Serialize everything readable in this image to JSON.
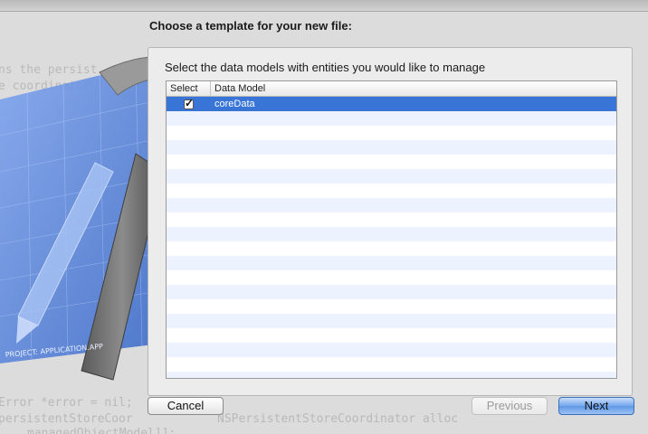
{
  "background_code": {
    "line1": "ns the persist",
    "line2": "e coordinator",
    "line3": "Error *error = nil;",
    "line4": "persistentStoreCoor",
    "line5": "NSPersistentStoreCoordinator alloc",
    "line6": "managedObjectModel]];"
  },
  "dialog": {
    "title": "Choose a template for your new file:",
    "heading": "Select the data models with entities you would like to manage"
  },
  "table": {
    "columns": [
      "Select",
      "Data Model"
    ],
    "rows": [
      {
        "selected_checkbox": true,
        "model": "coreData"
      }
    ]
  },
  "buttons": {
    "cancel": "Cancel",
    "previous": "Previous",
    "next": "Next"
  },
  "artwork": {
    "label": "PROJECT: APPLICATION.APP",
    "hammer_icon": "hammer-icon",
    "blueprint_icon": "blueprint-icon"
  },
  "colors": {
    "selection": "#3875d7",
    "default_button": "#5f98e6",
    "blueprint": "#4f7fd9"
  }
}
